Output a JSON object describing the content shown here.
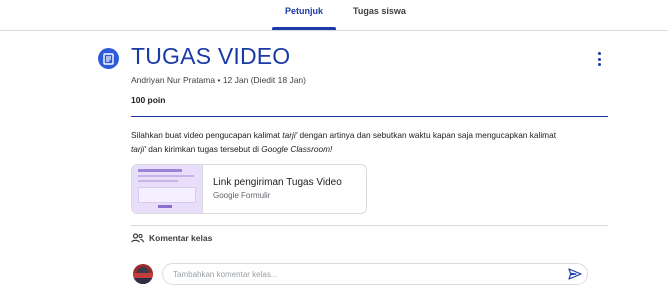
{
  "tabs": [
    {
      "label": "Petunjuk",
      "active": true
    },
    {
      "label": "Tugas siswa",
      "active": false
    }
  ],
  "assignment": {
    "icon": "assignment-icon",
    "title": "TUGAS VIDEO",
    "author": "Andriyan Nur Pratama",
    "separator": "•",
    "date": "12 Jan (Diedit 18 Jan)",
    "points": "100 poin",
    "description": {
      "part1": "Silahkan buat video pengucapan kalimat ",
      "term1": "tarji'",
      "part2": " dengan artinya dan sebutkan waktu kapan saja mengucapkan kalimat ",
      "term2": "tarji'",
      "part3": "dan kirimkan tugas tersebut di ",
      "term3": "Google Classroom!"
    }
  },
  "attachment": {
    "title": "Link pengiriman Tugas Video",
    "type": "Google Formulir"
  },
  "comments": {
    "heading": "Komentar kelas",
    "placeholder": "Tambahkan komentar kelas..."
  },
  "colors": {
    "accent": "#1a3aa8",
    "icon_bg": "#2e5bd9",
    "divider": "#dadce0",
    "form_thumb": "#e8defa"
  },
  "icons": {
    "more": "more-vert-icon",
    "comments": "people-icon",
    "send": "send-icon"
  }
}
